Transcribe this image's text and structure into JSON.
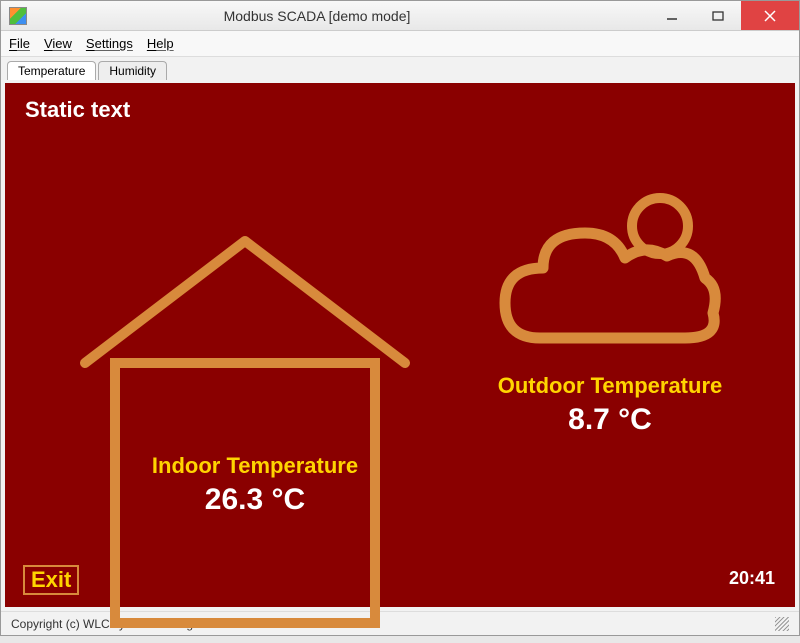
{
  "titlebar": {
    "title": "Modbus SCADA [demo mode]"
  },
  "menubar": {
    "file": "File",
    "view": "View",
    "settings": "Settings",
    "help": "Help"
  },
  "tabs": [
    {
      "label": "Temperature",
      "active": true
    },
    {
      "label": "Humidity",
      "active": false
    }
  ],
  "canvas": {
    "static_text": "Static text",
    "indoor": {
      "label": "Indoor Temperature",
      "value": "26.3 °C"
    },
    "outdoor": {
      "label": "Outdoor Temperature",
      "value": "8.7 °C"
    },
    "exit_label": "Exit",
    "clock": "20:41"
  },
  "statusbar": {
    "copyright": "Copyright (c) WLC systems. All rights reserved."
  },
  "colors": {
    "canvas_bg": "#8a0000",
    "accent": "#d88a3c",
    "label": "#ffd400"
  }
}
